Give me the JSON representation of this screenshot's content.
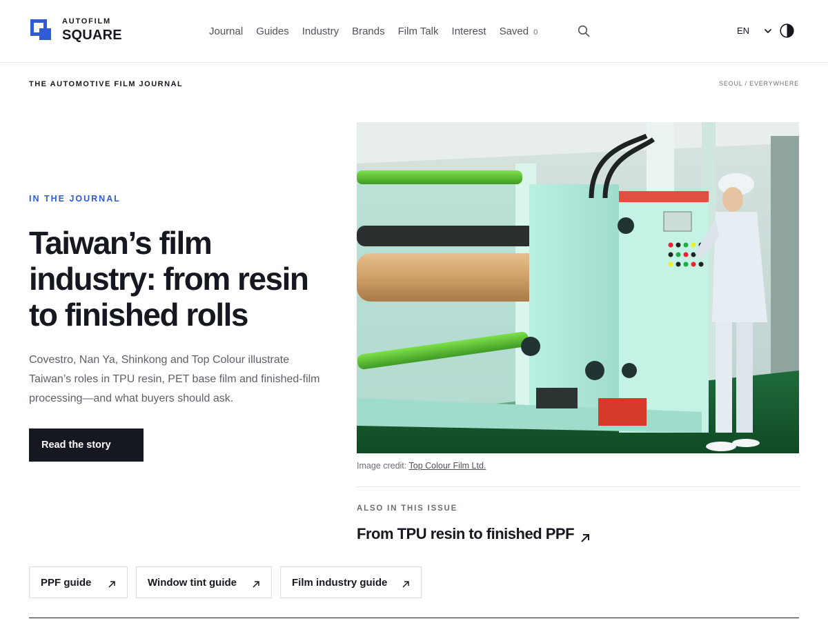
{
  "brand": {
    "small": "AUTOFILM",
    "name": "SQUARE",
    "accent_color": "#2f5bd9"
  },
  "nav": {
    "items": [
      {
        "label": "Journal"
      },
      {
        "label": "Guides"
      },
      {
        "label": "Industry"
      },
      {
        "label": "Brands"
      },
      {
        "label": "Film Talk"
      },
      {
        "label": "Interest"
      },
      {
        "label": "Saved"
      }
    ],
    "saved_count": "0",
    "search_icon": "search-icon",
    "language": "EN",
    "theme_icon": "contrast-icon"
  },
  "strip": {
    "left": "THE AUTOMOTIVE FILM JOURNAL",
    "right": "SEOUL / EVERYWHERE"
  },
  "hero": {
    "eyebrow": "IN THE JOURNAL",
    "headline": "Taiwan’s film industry: from resin to finished rolls",
    "dek": "Covestro, Nan Ya, Shinkong and Top Colour illustrate Taiwan’s roles in TPU resin, PET base film and finished-film processing—and what buyers should ask.",
    "cta": "Read the story",
    "image_credit_prefix": "Image credit:",
    "image_credit_link": "Top Colour Film Ltd."
  },
  "also": {
    "label": "ALSO IN THIS ISSUE",
    "title": "From TPU resin to finished PPF"
  },
  "guides": [
    {
      "label": "PPF guide"
    },
    {
      "label": "Window tint guide"
    },
    {
      "label": "Film industry guide"
    }
  ]
}
